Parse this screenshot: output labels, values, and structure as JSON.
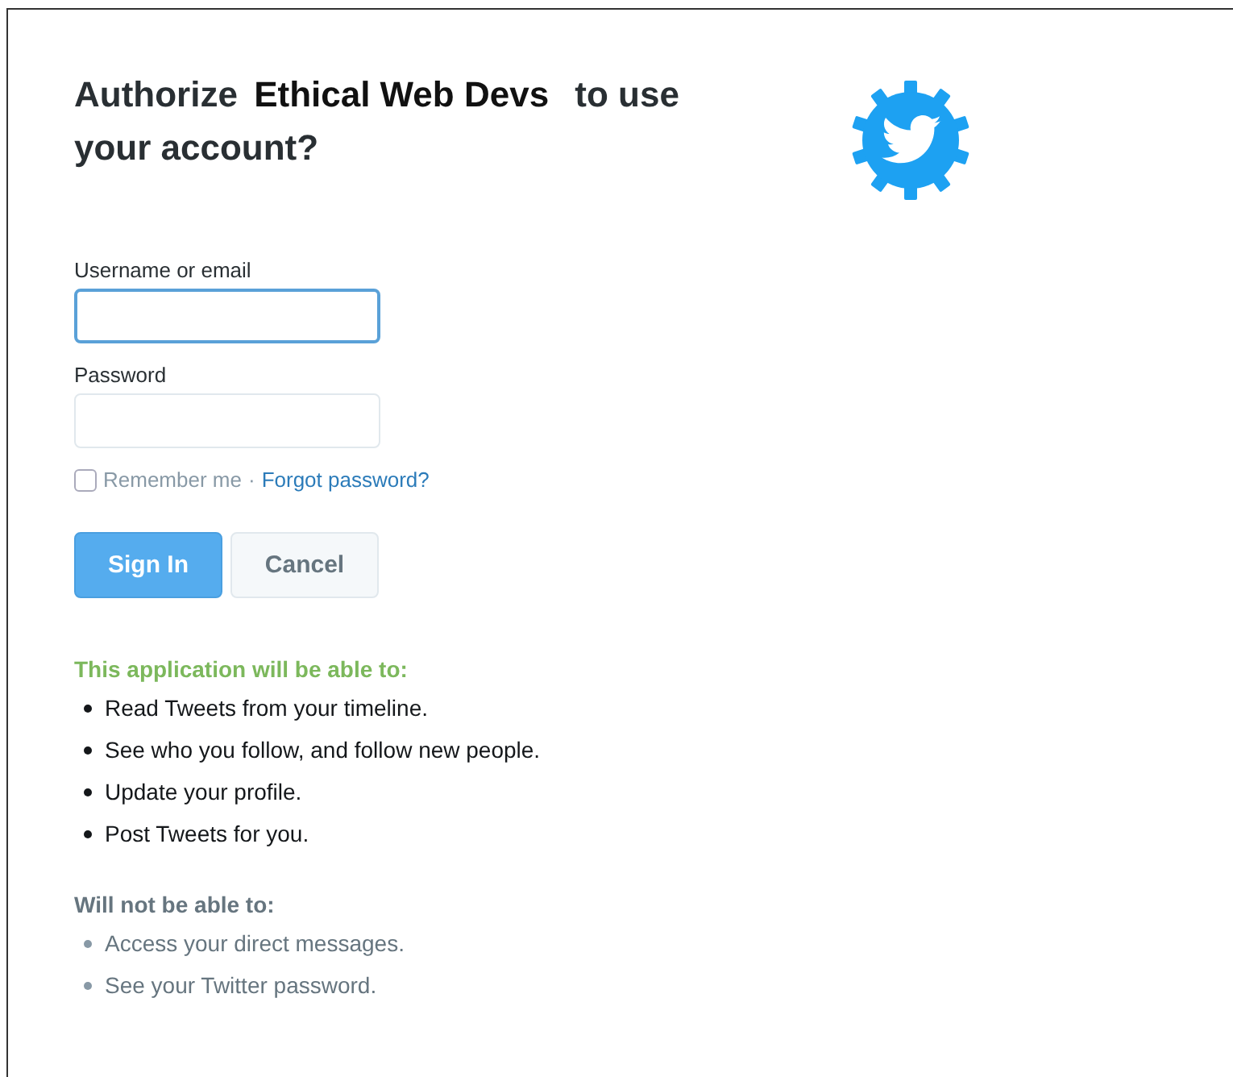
{
  "heading": {
    "before": "Authorize",
    "app_name": "Ethical Web Devs",
    "after": "to use your account?"
  },
  "fields": [
    {
      "label": "Username or email",
      "focused": true
    },
    {
      "label": "Password",
      "focused": false
    }
  ],
  "remember": {
    "label": "Remember me",
    "checked": false,
    "separator": "·",
    "link": "Forgot password?"
  },
  "buttons": [
    {
      "label": "Sign In",
      "kind": "primary"
    },
    {
      "label": "Cancel",
      "kind": "secondary"
    }
  ],
  "permissions": {
    "title": "This application will be able to:",
    "items": [
      "Read Tweets from your timeline.",
      "See who you follow, and follow new people.",
      "Update your profile.",
      "Post Tweets for you."
    ]
  },
  "restrictions": {
    "title": "Will not be able to:",
    "items": [
      "Access your direct messages.",
      "See your Twitter password."
    ]
  }
}
